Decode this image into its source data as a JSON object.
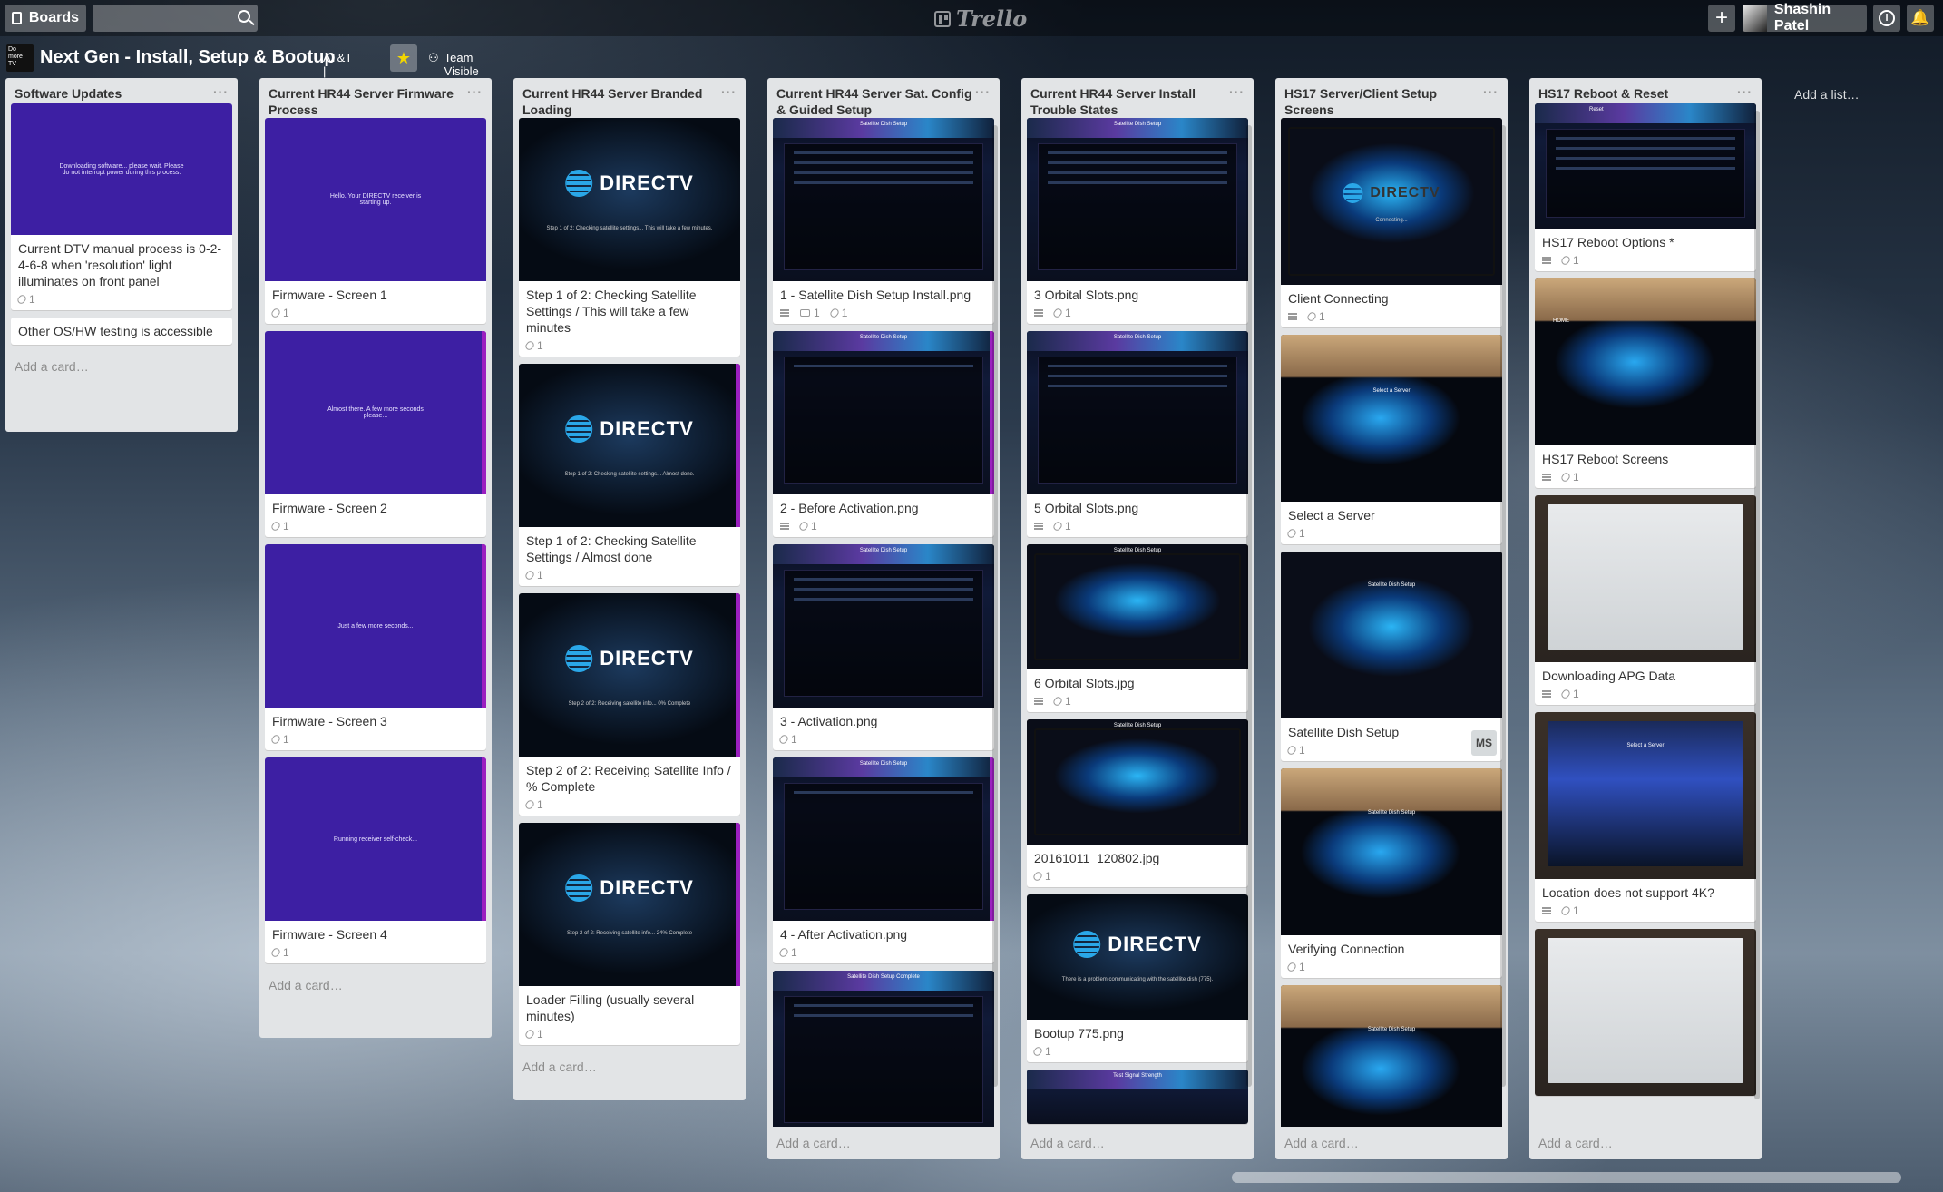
{
  "header": {
    "boards_label": "Boards",
    "search_placeholder": "",
    "logo_text": "Trello",
    "user_name": "Shashin Patel",
    "plus_label": "+",
    "info_label": "i",
    "bell_label": "🔔"
  },
  "board": {
    "logo_text": "Do more TV",
    "title": "Next Gen - Install, Setup & Bootup",
    "org": "AT&T | XDS",
    "star": "★",
    "visibility": "Team Visible"
  },
  "add_list_label": "Add a list…",
  "add_card_label": "Add a card…",
  "lists": [
    {
      "title": "Software Updates",
      "cards": [
        {
          "title": "Current DTV manual process is 0-2-4-6-8 when 'resolution' light illuminates on front panel",
          "attachments": "1",
          "thumb_text": "Downloading software... please wait. Please do not interrupt power during this process."
        },
        {
          "title": "Other OS/HW testing is accessible"
        }
      ]
    },
    {
      "title": "Current HR44 Server Firmware Process",
      "cards": [
        {
          "title": "Firmware - Screen 1",
          "attachments": "1",
          "thumb_text": "Hello. Your DIRECTV receiver is starting up."
        },
        {
          "title": "Firmware - Screen 2",
          "attachments": "1",
          "thumb_text": "Almost there. A few more seconds please..."
        },
        {
          "title": "Firmware - Screen 3",
          "attachments": "1",
          "thumb_text": "Just a few more seconds..."
        },
        {
          "title": "Firmware - Screen 4",
          "attachments": "1",
          "thumb_text": "Running receiver self-check..."
        }
      ]
    },
    {
      "title": "Current HR44 Server Branded Loading",
      "cards": [
        {
          "title": "Step 1 of 2: Checking Satellite Settings / This will take a few minutes",
          "attachments": "1",
          "logo": "DIRECTV",
          "thumb_text": "Step 1 of 2: Checking satellite settings... This will take a few minutes."
        },
        {
          "title": "Step 1 of 2: Checking Satellite Settings / Almost done",
          "attachments": "1",
          "logo": "DIRECTV",
          "thumb_text": "Step 1 of 2: Checking satellite settings... Almost done."
        },
        {
          "title": "Step 2 of 2: Receiving Satellite Info / % Complete",
          "attachments": "1",
          "logo": "DIRECTV",
          "thumb_text": "Step 2 of 2: Receiving satellite info... 0% Complete"
        },
        {
          "title": "Loader Filling (usually several minutes)",
          "attachments": "1",
          "logo": "DIRECTV",
          "thumb_text": "Step 2 of 2: Receiving satellite info... 24% Complete"
        }
      ]
    },
    {
      "title": "Current HR44 Server Sat. Config & Guided Setup",
      "cards": [
        {
          "title": "1 - Satellite Dish Setup Install.png",
          "comments": "1",
          "attachments": "1",
          "thumb_text": "Satellite Dish Setup"
        },
        {
          "title": "2 - Before Activation.png",
          "attachments": "1",
          "thumb_text": "Satellite Dish Setup"
        },
        {
          "title": "3 - Activation.png",
          "attachments": "1",
          "thumb_text": "Satellite Dish Setup"
        },
        {
          "title": "4 - After Activation.png",
          "attachments": "1",
          "thumb_text": "Satellite Dish Setup"
        },
        {
          "title": "",
          "thumb_text": "Satellite Dish Setup Complete"
        }
      ]
    },
    {
      "title": "Current HR44 Server Install Trouble States",
      "cards": [
        {
          "title": "3 Orbital Slots.png",
          "attachments": "1",
          "thumb_text": "Satellite Dish Setup"
        },
        {
          "title": "5 Orbital Slots.png",
          "attachments": "1",
          "thumb_text": "Satellite Dish Setup"
        },
        {
          "title": "6 Orbital Slots.jpg",
          "attachments": "1",
          "thumb_text": "Satellite Dish Setup"
        },
        {
          "title": "20161011_120802.jpg",
          "attachments": "1",
          "thumb_text": "Satellite Dish Setup"
        },
        {
          "title": "Bootup 775.png",
          "attachments": "1",
          "logo": "DIRECTV",
          "thumb_text": "There is a problem communicating with the satellite dish (775)."
        },
        {
          "title": "",
          "thumb_text": "Test Signal Strength"
        }
      ]
    },
    {
      "title": "HS17 Server/Client Setup Screens",
      "cards": [
        {
          "title": "Client Connecting",
          "attachments": "1",
          "logo": "DIRECTV",
          "thumb_text": "Connecting..."
        },
        {
          "title": "Select a Server",
          "attachments": "1",
          "thumb_text": "Select a Server"
        },
        {
          "title": "Satellite Dish Setup",
          "attachments": "1",
          "member": "MS",
          "thumb_text": "Satellite Dish Setup"
        },
        {
          "title": "Verifying Connection",
          "attachments": "1",
          "thumb_text": "Satellite Dish Setup"
        },
        {
          "title": "",
          "thumb_text": "Satellite Dish Setup"
        }
      ]
    },
    {
      "title": "HS17 Reboot & Reset",
      "cards": [
        {
          "title": "HS17 Reboot Options *",
          "attachments": "1",
          "thumb_text": "Reset"
        },
        {
          "title": "HS17 Reboot Screens",
          "attachments": "1",
          "thumb_text": "HOME"
        },
        {
          "title": "Downloading APG Data",
          "attachments": "1"
        },
        {
          "title": "Location does not support 4K?",
          "attachments": "1",
          "thumb_text": "Select a Server"
        },
        {
          "title": ""
        }
      ]
    }
  ]
}
